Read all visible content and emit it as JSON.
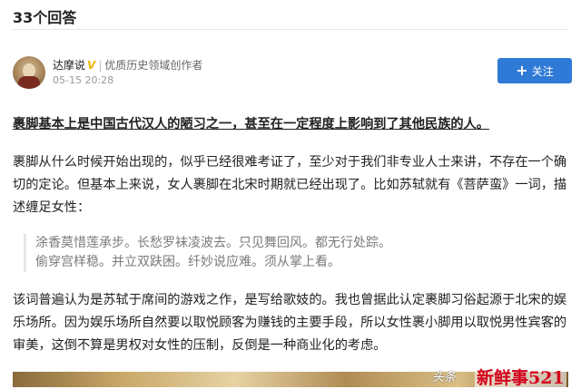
{
  "header": {
    "answer_count": "33个回答"
  },
  "author": {
    "name": "达摩说",
    "verified_mark": "V",
    "separator": "|",
    "title": "优质历史领域创作者",
    "date": "05-15 20:28",
    "follow_label": "关注",
    "follow_icon": "plus-icon"
  },
  "article": {
    "p1": "裹脚基本上是中国古代汉人的陋习之一，甚至在一定程度上影响到了其他民族的人。",
    "p2": "裹脚从什么时候开始出现的，似乎已经很难考证了，至少对于我们非专业人士来讲，不存在一个确切的定论。但基本上来说，女人裹脚在北宋时期就已经出现了。比如苏轼就有《菩萨蛮》一词，描述缠足女性：",
    "quote_line1": "涂香莫惜莲承步。长愁罗袜凌波去。只见舞回风。都无行处踪。",
    "quote_line2": "偷穿宫样稳。并立双趺困。纤妙说应难。须从掌上看。",
    "p3": "该词普遍认为是苏轼于席间的游戏之作，是写给歌妓的。我也曾据此认定裹脚习俗起源于北宋的娱乐场所。因为娱乐场所自然要以取悦顾客为赚钱的主要手段，所以女性裹小脚用以取悦男性宾客的审美，这倒不算是男权对女性的压制，反倒是一种商业化的考虑。"
  },
  "watermark": {
    "source": "头条",
    "brand": "新鲜事521"
  },
  "colors": {
    "follow_button": "#2f7ad6",
    "verified": "#f2b600",
    "brand_watermark": "#d4001c"
  }
}
